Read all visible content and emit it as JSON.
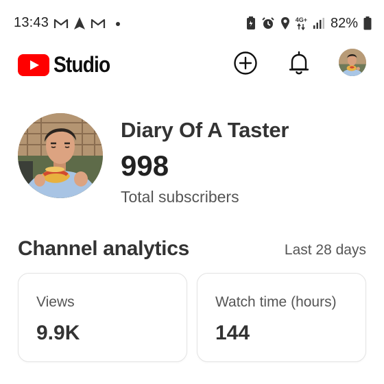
{
  "status_bar": {
    "time": "13:43",
    "left_icons": [
      "gmail-icon",
      "navigation-icon",
      "gmail-icon",
      "dot-icon"
    ],
    "right_icons": [
      "battery-saver-icon",
      "alarm-icon",
      "location-icon",
      "network-4g-icon",
      "signal-icon",
      "battery-icon"
    ],
    "network_label": "4G+",
    "battery_percent": "82%"
  },
  "app_bar": {
    "logo_text": "Studio",
    "brand_color": "#ff0000",
    "actions": [
      "create-icon",
      "notifications-icon",
      "account-avatar"
    ]
  },
  "channel": {
    "name": "Diary Of A Taster",
    "subscriber_count": "998",
    "subscriber_label": "Total subscribers"
  },
  "analytics": {
    "title": "Channel analytics",
    "range": "Last 28 days",
    "cards": [
      {
        "label": "Views",
        "value": "9.9K"
      },
      {
        "label": "Watch time (hours)",
        "value": "144"
      }
    ]
  }
}
